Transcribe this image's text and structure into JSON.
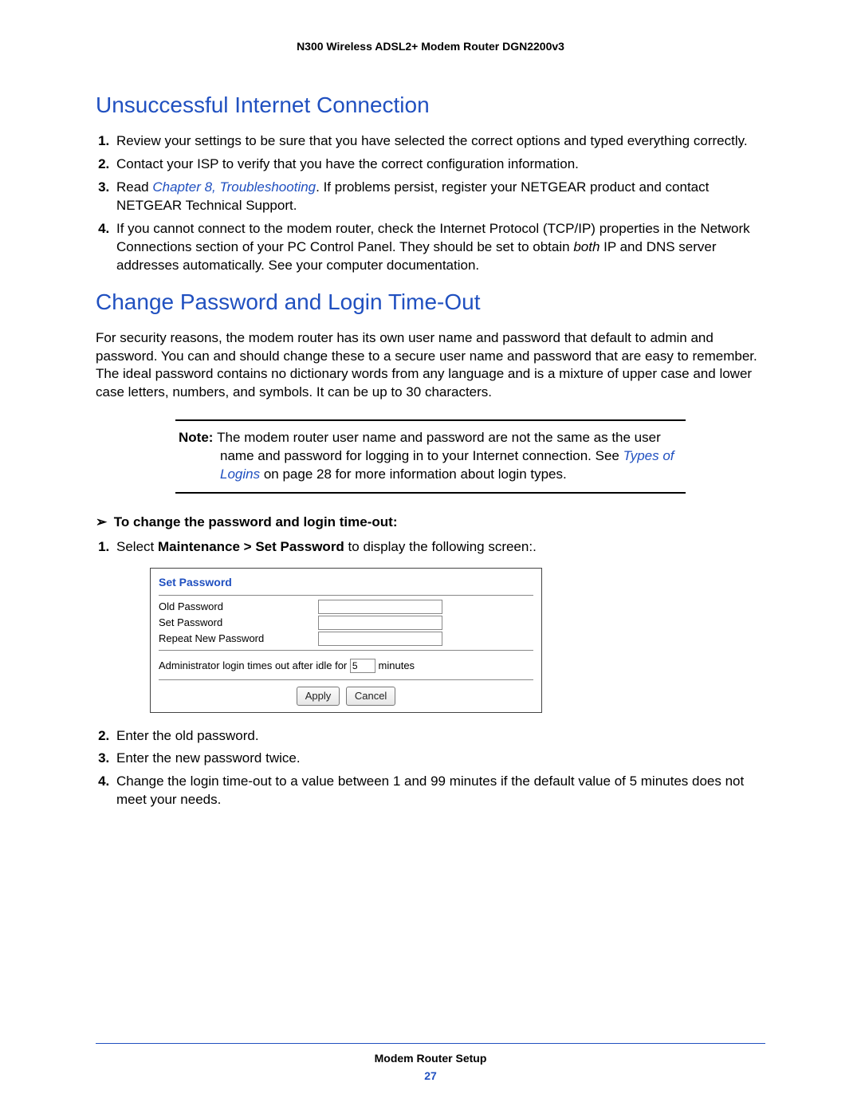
{
  "header": {
    "doc_title": "N300 Wireless ADSL2+ Modem Router DGN2200v3"
  },
  "section1": {
    "title": "Unsuccessful Internet Connection",
    "items": {
      "i1": "Review your settings to be sure that you have selected the correct options and typed everything correctly.",
      "i2": "Contact your ISP to verify that you have the correct configuration information.",
      "i3_pre": "Read ",
      "i3_link": "Chapter 8, Troubleshooting",
      "i3_post": ". If problems persist, register your NETGEAR product and contact NETGEAR Technical Support.",
      "i4_a": "If you cannot connect to the modem router, check the Internet Protocol (TCP/IP) properties in the Network Connections section of your PC Control Panel. They should be set to obtain ",
      "i4_both": "both",
      "i4_b": " IP and DNS server addresses automatically. See your computer documentation."
    }
  },
  "section2": {
    "title": "Change Password and Login Time-Out",
    "intro": "For security reasons, the modem router has its own user name and password that default to admin and password. You can and should change these to a secure user name and password that are easy to remember. The ideal password contains no dictionary words from any language and is a mixture of upper case and lower case letters, numbers, and symbols. It can be up to 30 characters."
  },
  "note": {
    "label": "Note:  ",
    "text_a": "The modem router user name and password are not the same as the user name and password for logging in to your Internet connection. See ",
    "link": "Types of Logins",
    "text_b": " on page 28 for more information about login types."
  },
  "procedure": {
    "heading": "To change the password and login time-out:",
    "s1_a": "Select ",
    "s1_b": "Maintenance > Set Password",
    "s1_c": " to display the following screen:.",
    "s2": "Enter the old password.",
    "s3": "Enter the new password twice.",
    "s4": "Change the login time-out to a value between 1 and 99 minutes if the default value of 5 minutes does not meet your needs."
  },
  "ui": {
    "title": "Set Password",
    "old": "Old Password",
    "set": "Set Password",
    "repeat": "Repeat New Password",
    "idle_pre": "Administrator login times out after idle for",
    "idle_val": "5",
    "idle_post": "minutes",
    "apply": "Apply",
    "cancel": "Cancel"
  },
  "footer": {
    "title": "Modem Router Setup",
    "page": "27"
  }
}
